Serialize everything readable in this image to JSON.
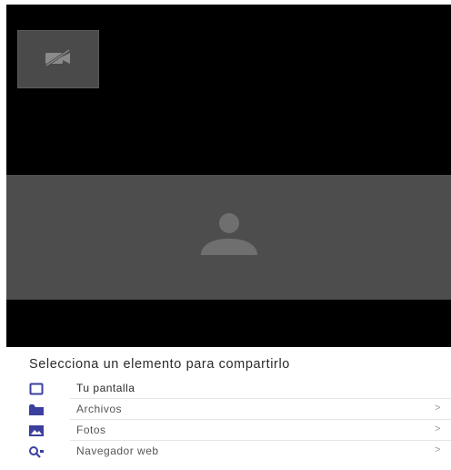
{
  "video": {
    "self_view_icon": "video-off-icon",
    "remote_avatar_icon": "person-icon"
  },
  "share_sheet": {
    "title": "Selecciona un elemento para compartirlo",
    "options": [
      {
        "label": "Tu pantalla",
        "icon": "screen-icon",
        "chevron": ""
      },
      {
        "label": "Archivos",
        "icon": "folder-icon",
        "chevron": ">"
      },
      {
        "label": "Fotos",
        "icon": "photos-icon",
        "chevron": ">"
      },
      {
        "label": "Navegador web",
        "icon": "web-search-icon",
        "chevron": ">"
      }
    ]
  },
  "colors": {
    "accent": "#3b3f9e",
    "video_bg": "#000000",
    "tile_bg": "#4d4d4d"
  }
}
